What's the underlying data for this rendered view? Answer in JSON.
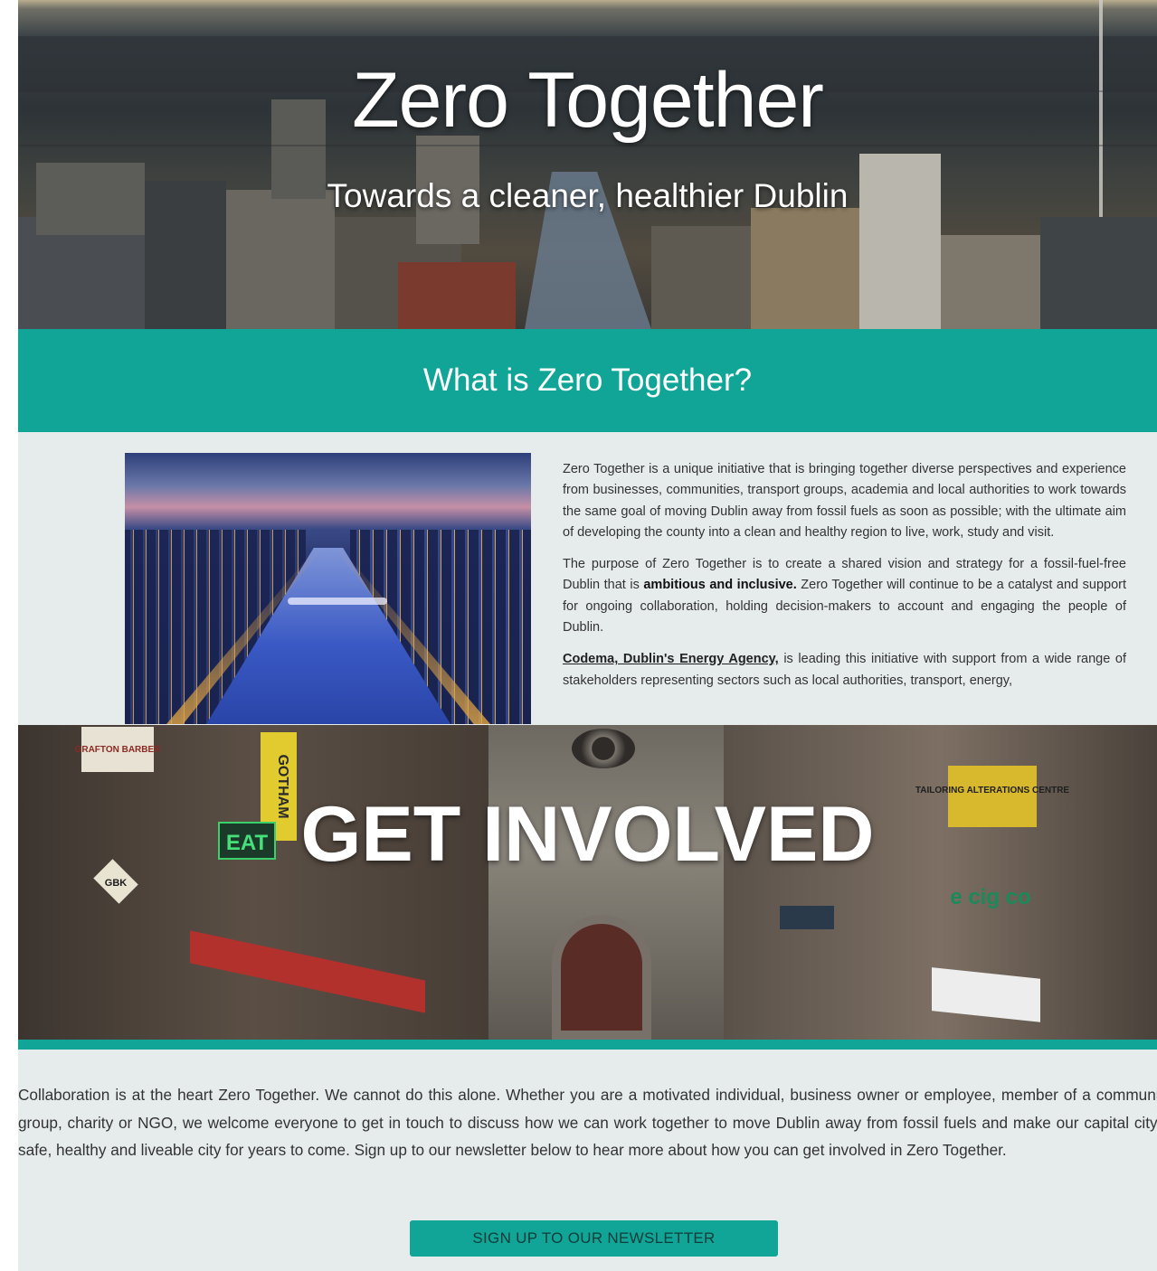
{
  "hero": {
    "title": "Zero Together",
    "subtitle": "Towards a cleaner, healthier Dublin"
  },
  "what_is": {
    "heading": "What is Zero Together?"
  },
  "about": {
    "p1": "Zero Together is a unique initiative that is bringing together diverse perspectives and experience from businesses, communities, transport groups, academia and local authorities to work towards the same goal of moving Dublin away from fossil fuels as soon as possible; with the ultimate aim of developing the county into a clean and healthy region to live, work, study and visit.",
    "p2_before": "The purpose of Zero Together is to create a shared vision and strategy for a fossil-fuel-free Dublin that is ",
    "p2_bold": "ambitious and inclusive.",
    "p2_after": " Zero Together will continue to be a catalyst and support for ongoing collaboration, holding decision-makers to account and engaging the people of Dublin.",
    "p3_link": "Codema, Dublin's Energy Agency,",
    "p3_after": " is leading this initiative with support from a wide range of stakeholders representing sectors such as local authorities, transport, energy,"
  },
  "involved": {
    "heading": "GET INVOLVED",
    "signs": {
      "barber": "GRAFTON BARBER",
      "gotham": "GOTHAM",
      "eat": "EAT",
      "gbk": "GBK",
      "tailoring": "TAILORING ALTERATIONS CENTRE",
      "ecigco": "e cig co"
    }
  },
  "collab": {
    "text": "Collaboration is at the heart Zero Together. We cannot do this alone. Whether you are a motivated individual, business owner or employee, member of a community group, charity or NGO, we welcome everyone to get in touch to discuss how we can work together to move Dublin away from fossil fuels and make our capital city a safe, healthy and liveable city for years to come. Sign up to our newsletter below to hear more about how you can get involved in Zero Together."
  },
  "newsletter": {
    "button_label": "SIGN UP TO OUR NEWSLETTER"
  },
  "colors": {
    "accent": "#10a597",
    "background": "#e6ecec"
  }
}
